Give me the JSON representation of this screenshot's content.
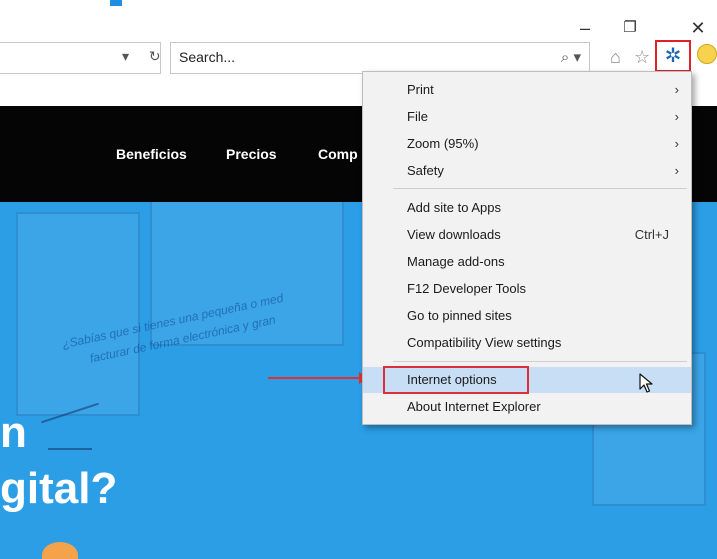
{
  "browser": {
    "window_controls": [
      "–",
      "❐",
      "✕"
    ],
    "address_controls": "▾ ↻",
    "search": {
      "placeholder": "Search...",
      "icons": "⌕ ▾"
    },
    "toolbar_icons": {
      "home": "⌂",
      "favorites": "☆",
      "tools": "✲"
    }
  },
  "site": {
    "nav": [
      "Beneficios",
      "Precios",
      "Comp"
    ],
    "hero_text_lines": [
      "¿Sabías que si tienes una pequeña o med",
      "facturar de forma electrónica y gran"
    ],
    "hero_title_lines": [
      "n",
      "gital?"
    ]
  },
  "tools_menu": {
    "group1": [
      {
        "label": "Print",
        "chevron": "›"
      },
      {
        "label": "File",
        "chevron": "›"
      },
      {
        "label": "Zoom (95%)",
        "chevron": "›"
      },
      {
        "label": "Safety",
        "chevron": "›"
      }
    ],
    "group2": [
      {
        "label": "Add site to Apps",
        "shortcut": ""
      },
      {
        "label": "View downloads",
        "shortcut": "Ctrl+J"
      },
      {
        "label": "Manage add-ons",
        "shortcut": ""
      },
      {
        "label": "F12 Developer Tools",
        "shortcut": ""
      },
      {
        "label": "Go to pinned sites",
        "shortcut": ""
      },
      {
        "label": "Compatibility View settings",
        "shortcut": ""
      }
    ],
    "group3": [
      {
        "label": "Internet options",
        "highlighted": true
      },
      {
        "label": "About Internet Explorer",
        "highlighted": false
      }
    ]
  },
  "colors": {
    "accent_red": "#e02d3a",
    "gear_blue": "#1b65b5",
    "hover_blue": "#c8def5",
    "hero_blue": "#2b9ee6"
  }
}
